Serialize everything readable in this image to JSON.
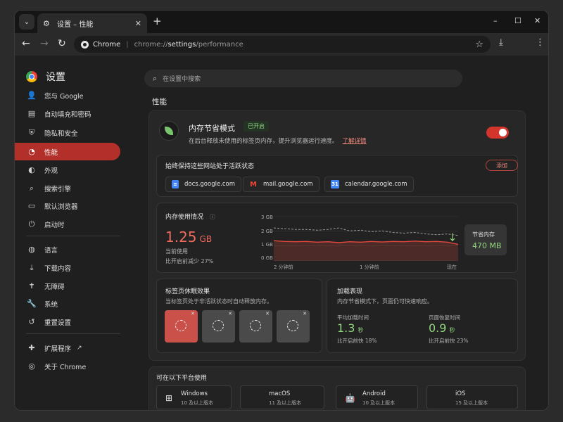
{
  "tab": {
    "title": "设置 – 性能",
    "close": "✕",
    "new": "+"
  },
  "window_controls": {
    "minimize": "–",
    "maximize": "☐",
    "close": "✕"
  },
  "omnibox": {
    "site": "Chrome",
    "url_prefix": "chrome://",
    "url_main": "settings",
    "url_suffix": "/performance"
  },
  "sidebar": {
    "brand": "设置",
    "items": [
      {
        "label": "您与 Google",
        "icon": "person-icon"
      },
      {
        "label": "自动填充和密码",
        "icon": "clipboard-icon"
      },
      {
        "label": "隐私和安全",
        "icon": "shield-icon"
      },
      {
        "label": "性能",
        "icon": "speedometer-icon",
        "active": true
      },
      {
        "label": "外观",
        "icon": "palette-icon"
      },
      {
        "label": "搜索引擎",
        "icon": "search-icon"
      },
      {
        "label": "默认浏览器",
        "icon": "browser-icon"
      },
      {
        "label": "启动时",
        "icon": "power-icon"
      },
      {
        "label": "语言",
        "icon": "globe-icon"
      },
      {
        "label": "下载内容",
        "icon": "download-icon"
      },
      {
        "label": "无障碍",
        "icon": "accessibility-icon"
      },
      {
        "label": "系统",
        "icon": "wrench-icon"
      },
      {
        "label": "重置设置",
        "icon": "reset-icon"
      },
      {
        "label": "扩展程序",
        "icon": "puzzle-icon"
      },
      {
        "label": "关于 Chrome",
        "icon": "chrome-icon"
      }
    ]
  },
  "search": {
    "placeholder": "在设置中搜索"
  },
  "section_title": "性能",
  "memory_saver": {
    "title": "内存节省模式",
    "badge": "已开启",
    "description": "在后台释放未使用的标签页内存，提升浏览器运行速度。",
    "link": "了解详情",
    "enabled": true
  },
  "active_sites": {
    "title": "始终保持这些网站处于活跃状态",
    "add_button": "添加",
    "sites": [
      {
        "name": "docs.google.com",
        "color": "#4285f4"
      },
      {
        "name": "mail.google.com",
        "color": "#ea4335"
      },
      {
        "name": "calendar.google.com",
        "color": "#4285f4"
      }
    ]
  },
  "memory_usage": {
    "title": "内存使用情况",
    "value": "1.25",
    "unit": "GB",
    "current_label": "当前使用",
    "reduced_label": "比开启前减少 27%",
    "saved_label": "节省内存",
    "saved_value": "470 MB"
  },
  "chart_data": {
    "type": "line",
    "x_labels": [
      "2 分钟前",
      "1 分钟前",
      "现在"
    ],
    "y_ticks": [
      "3 GB",
      "2 GB",
      "1 GB",
      "0 GB"
    ],
    "ylim": [
      0,
      3
    ],
    "series": [
      {
        "style": "dashed",
        "color": "#9a9a9a",
        "values": [
          2.2,
          2.15,
          2.1,
          2.1,
          2.05,
          2.1,
          2.2,
          2.0,
          2.05,
          1.95,
          2.0,
          1.9,
          1.85,
          1.9,
          1.8,
          1.75,
          1.8,
          1.7
        ]
      },
      {
        "style": "solid",
        "color": "#e2483c",
        "values": [
          1.35,
          1.3,
          1.28,
          1.3,
          1.25,
          1.28,
          1.22,
          1.28,
          1.25,
          1.3,
          1.26,
          1.3,
          1.28,
          1.32,
          1.28,
          1.3,
          1.25,
          1.1
        ]
      }
    ]
  },
  "tab_sleep": {
    "title": "标签页休眠效果",
    "subtitle": "当标签页处于非活跃状态时自动释放内存。",
    "tiles": 4
  },
  "load_perf": {
    "title": "加载表现",
    "subtitle": "内存节省模式下，页面仍可快速响应。",
    "avg_label": "平均加载时间",
    "avg_value": "1.3",
    "avg_unit": "秒",
    "avg_note": "比开启前快 18%",
    "restore_label": "页面恢复时间",
    "restore_value": "0.9",
    "restore_unit": "秒",
    "restore_note": "比开启前快 23%"
  },
  "platforms": {
    "title": "可在以下平台使用",
    "items": [
      {
        "name": "Windows",
        "version": "10 及以上版本",
        "icon": "windows-icon"
      },
      {
        "name": "macOS",
        "version": "11 及以上版本",
        "icon": "apple-icon"
      },
      {
        "name": "Android",
        "version": "10 及以上版本",
        "icon": "android-icon"
      },
      {
        "name": "iOS",
        "version": "15 及以上版本",
        "icon": "apple-icon"
      }
    ]
  }
}
